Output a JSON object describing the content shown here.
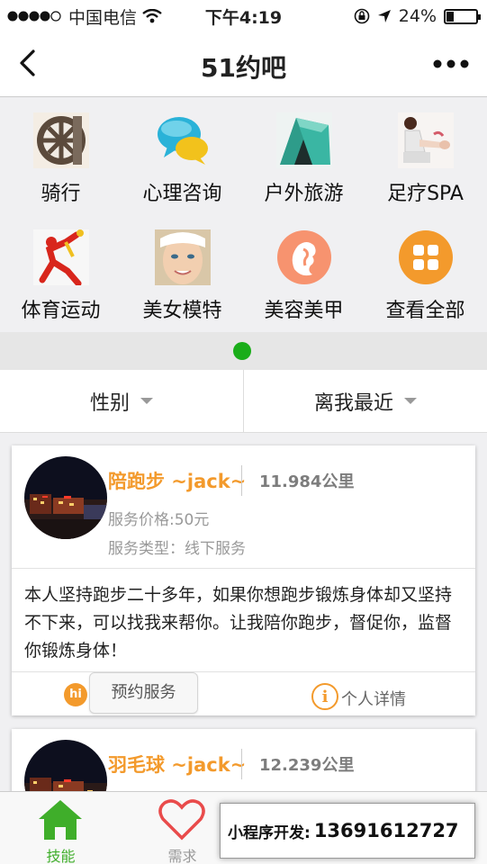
{
  "status": {
    "carrier": "中国电信",
    "time": "下午4:19",
    "battery": "24%",
    "battery_level": 0.24
  },
  "nav": {
    "title": "51约吧"
  },
  "categories": [
    {
      "label": "骑行",
      "icon": "bike-wheel-icon"
    },
    {
      "label": "心理咨询",
      "icon": "chat-bubbles-icon"
    },
    {
      "label": "户外旅游",
      "icon": "tent-icon"
    },
    {
      "label": "足疗SPA",
      "icon": "foot-spa-icon"
    },
    {
      "label": "体育运动",
      "icon": "sports-icon"
    },
    {
      "label": "美女模特",
      "icon": "model-face-icon"
    },
    {
      "label": "美容美甲",
      "icon": "beauty-icon"
    },
    {
      "label": "查看全部",
      "icon": "grid-icon"
    }
  ],
  "filters": {
    "gender": "性别",
    "nearest": "离我最近"
  },
  "cards": [
    {
      "name": "陪跑步 ~jack~",
      "distance": "11.984公里",
      "price": "服务价格:50元",
      "type": "服务类型：线下服务",
      "description": "本人坚持跑步二十多年，如果你想跑步锻炼身体却又坚持不下来，可以找我来帮你。让我陪你跑步，督促你，监督你锻炼身体！",
      "hi": "hi",
      "book": "预约服务",
      "detail": "个人详情"
    },
    {
      "name": "羽毛球 ~jack~",
      "distance": "12.239公里"
    }
  ],
  "tabs": [
    {
      "label": "技能",
      "icon": "home-icon",
      "color": "#3fae2a"
    },
    {
      "label": "需求",
      "icon": "heart-icon",
      "color": "#e94b4b"
    }
  ],
  "promo": {
    "label": "小程序开发:",
    "phone": "13691612727"
  },
  "colors": {
    "accent": "#f39a2c",
    "green": "#1aad19"
  }
}
